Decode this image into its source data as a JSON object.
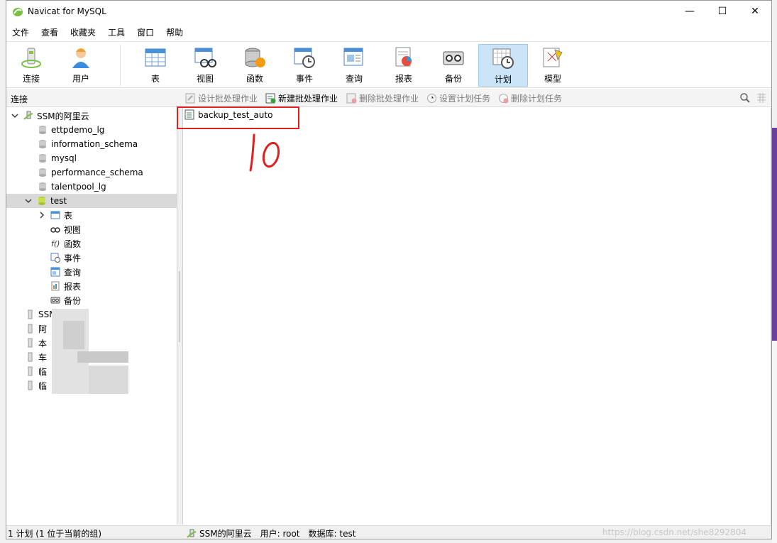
{
  "window": {
    "title": "Navicat for MySQL"
  },
  "window_controls": {
    "minimize": "—",
    "maximize": "☐",
    "close": "✕"
  },
  "menu": [
    "文件",
    "查看",
    "收藏夹",
    "工具",
    "窗口",
    "帮助"
  ],
  "toolbar": {
    "items": [
      {
        "label": "连接",
        "icon": "connection-icon"
      },
      {
        "label": "用户",
        "icon": "user-icon"
      },
      {
        "label": "表",
        "icon": "table-icon"
      },
      {
        "label": "视图",
        "icon": "view-icon"
      },
      {
        "label": "函数",
        "icon": "function-icon"
      },
      {
        "label": "事件",
        "icon": "event-icon"
      },
      {
        "label": "查询",
        "icon": "query-icon"
      },
      {
        "label": "报表",
        "icon": "report-icon"
      },
      {
        "label": "备份",
        "icon": "backup-icon"
      },
      {
        "label": "计划",
        "icon": "schedule-icon",
        "active": true
      },
      {
        "label": "模型",
        "icon": "model-icon"
      }
    ]
  },
  "subheader": {
    "panel_label": "连接",
    "actions": [
      {
        "label": "设计批处理作业",
        "enabled": false
      },
      {
        "label": "新建批处理作业",
        "enabled": true
      },
      {
        "label": "删除批处理作业",
        "enabled": false
      },
      {
        "label": "设置计划任务",
        "enabled": false
      },
      {
        "label": "删除计划任务",
        "enabled": false
      }
    ]
  },
  "tree": {
    "root": "SSM的阿里云",
    "databases": [
      "ettpdemo_lg",
      "information_schema",
      "mysql",
      "performance_schema",
      "talentpool_lg",
      "test"
    ],
    "test_children": [
      "表",
      "视图",
      "函数",
      "事件",
      "查询",
      "报表",
      "备份"
    ],
    "other_connections": [
      "SSM",
      "阿",
      "本",
      "车",
      "临",
      "临"
    ]
  },
  "content": {
    "jobs": [
      "backup_test_auto"
    ],
    "annotation": "10"
  },
  "status": {
    "left": "1 计划 (1 位于当前的组)",
    "connection": "SSM的阿里云",
    "user": "用户: root",
    "database": "数据库: test",
    "watermark": "https://blog.csdn.net/she8292804"
  },
  "colors": {
    "active_toolbar": "#cce4f7",
    "highlight_box": "#e02020",
    "selected_row": "#d9d9d9"
  }
}
